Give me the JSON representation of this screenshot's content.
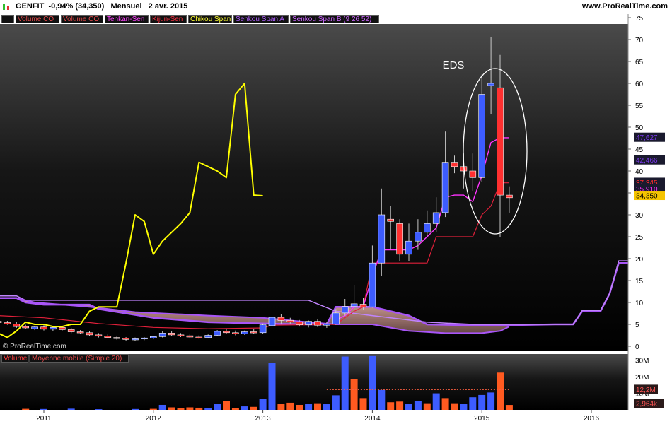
{
  "header": {
    "ticker_line": "GENFIT  -0,94% (34,350)   Mensuel   2 avr. 2015",
    "site": "www.ProRealTime.com",
    "copyright": "© ProRealTime.com"
  },
  "legend": [
    {
      "label": "",
      "color": "#bbbbbb"
    },
    {
      "label": "Volume CO",
      "color": "#e34a4a"
    },
    {
      "label": "Volume CO",
      "color": "#e34a4a"
    },
    {
      "label": "Tenkan-Sen",
      "color": "#ff44ff"
    },
    {
      "label": "Kijun-Sen",
      "color": "#ff3344"
    },
    {
      "label": "Chikou Span",
      "color": "#ffff33"
    },
    {
      "label": "Senkou Span A",
      "color": "#b060ff"
    },
    {
      "label": "Senkou Span B (9 26 52)",
      "color": "#cc66ff"
    }
  ],
  "volume_legend": [
    {
      "label": "Volume",
      "color": "#ff4040"
    },
    {
      "label": "Moyenne mobile (Simple 20)",
      "color": "#e34a4a"
    }
  ],
  "annotation": "EDS",
  "colors": {
    "up": "#3d5cff",
    "down": "#ff3030",
    "vol_up": "#3d5cff",
    "vol_down": "#ff5a20",
    "tenkan": "#ff33ff",
    "kijun": "#e0203a",
    "chikou": "#ffff00",
    "senkou_b": "#a855f7",
    "cloud_top": "#e7b0a6",
    "cloud_bottom": "#6b4a48"
  },
  "chart_data": {
    "type": "candlestick",
    "title": "GENFIT Mensuel",
    "ylim": [
      0,
      76
    ],
    "y_ticks": [
      "0",
      "5",
      "10",
      "15",
      "20",
      "25",
      "30",
      "35",
      "40",
      "45",
      "50",
      "55",
      "60",
      "65",
      "70",
      "75"
    ],
    "x_axis_ticks": [
      {
        "label": "2011",
        "m": 0
      },
      {
        "label": "2012",
        "m": 12
      },
      {
        "label": "2013",
        "m": 24
      },
      {
        "label": "2014",
        "m": 36
      },
      {
        "label": "2015",
        "m": 48
      },
      {
        "label": "2016",
        "m": 60
      }
    ],
    "price_labels": [
      {
        "text": "47,627",
        "value": 47.627,
        "color": "#7c3aed"
      },
      {
        "text": "42,466",
        "value": 42.466,
        "color": "#7c3aed"
      },
      {
        "text": "37,345",
        "value": 37.345,
        "color": "#ff2d2d"
      },
      {
        "text": "35,910",
        "value": 35.91,
        "color": "#ff2dff"
      },
      {
        "text": "34,350",
        "value": 34.35,
        "color": "#f5c400"
      }
    ],
    "candles": [
      {
        "m": -5,
        "o": 5.7,
        "h": 6.2,
        "l": 5.0,
        "c": 5.4
      },
      {
        "m": -4,
        "o": 5.4,
        "h": 5.8,
        "l": 4.9,
        "c": 5.1
      },
      {
        "m": -3,
        "o": 5.1,
        "h": 5.5,
        "l": 4.2,
        "c": 4.5
      },
      {
        "m": -2,
        "o": 4.5,
        "h": 4.9,
        "l": 3.9,
        "c": 4.2
      },
      {
        "m": -1,
        "o": 4.0,
        "h": 4.6,
        "l": 3.7,
        "c": 4.4
      },
      {
        "m": 0,
        "o": 4.4,
        "h": 4.8,
        "l": 3.6,
        "c": 3.9
      },
      {
        "m": 1,
        "o": 3.9,
        "h": 4.5,
        "l": 3.4,
        "c": 4.3
      },
      {
        "m": 2,
        "o": 4.3,
        "h": 4.6,
        "l": 3.5,
        "c": 3.8
      },
      {
        "m": 3,
        "o": 3.8,
        "h": 4.2,
        "l": 3.0,
        "c": 3.3
      },
      {
        "m": 4,
        "o": 3.3,
        "h": 3.7,
        "l": 2.8,
        "c": 3.1
      },
      {
        "m": 5,
        "o": 3.1,
        "h": 3.4,
        "l": 2.3,
        "c": 2.6
      },
      {
        "m": 6,
        "o": 2.6,
        "h": 3.0,
        "l": 2.0,
        "c": 2.3
      },
      {
        "m": 7,
        "o": 2.3,
        "h": 2.7,
        "l": 1.8,
        "c": 2.0
      },
      {
        "m": 8,
        "o": 2.0,
        "h": 2.4,
        "l": 1.5,
        "c": 1.8
      },
      {
        "m": 9,
        "o": 1.8,
        "h": 2.1,
        "l": 1.3,
        "c": 1.6
      },
      {
        "m": 10,
        "o": 1.6,
        "h": 2.0,
        "l": 1.2,
        "c": 1.7
      },
      {
        "m": 11,
        "o": 1.7,
        "h": 2.1,
        "l": 1.4,
        "c": 1.9
      },
      {
        "m": 12,
        "o": 1.9,
        "h": 2.4,
        "l": 1.6,
        "c": 2.2
      },
      {
        "m": 13,
        "o": 2.2,
        "h": 3.5,
        "l": 2.0,
        "c": 3.0
      },
      {
        "m": 14,
        "o": 3.0,
        "h": 3.4,
        "l": 2.4,
        "c": 2.6
      },
      {
        "m": 15,
        "o": 2.6,
        "h": 3.0,
        "l": 2.1,
        "c": 2.4
      },
      {
        "m": 16,
        "o": 2.4,
        "h": 2.8,
        "l": 1.8,
        "c": 2.1
      },
      {
        "m": 17,
        "o": 2.1,
        "h": 2.5,
        "l": 1.7,
        "c": 2.0
      },
      {
        "m": 18,
        "o": 2.0,
        "h": 2.7,
        "l": 1.8,
        "c": 2.5
      },
      {
        "m": 19,
        "o": 2.5,
        "h": 3.7,
        "l": 2.3,
        "c": 3.4
      },
      {
        "m": 20,
        "o": 3.4,
        "h": 3.9,
        "l": 2.8,
        "c": 3.1
      },
      {
        "m": 21,
        "o": 3.1,
        "h": 3.6,
        "l": 2.5,
        "c": 2.8
      },
      {
        "m": 22,
        "o": 2.8,
        "h": 3.6,
        "l": 2.6,
        "c": 3.3
      },
      {
        "m": 23,
        "o": 3.3,
        "h": 4.0,
        "l": 2.9,
        "c": 3.1
      },
      {
        "m": 24,
        "o": 3.1,
        "h": 5.2,
        "l": 2.9,
        "c": 4.9
      },
      {
        "m": 25,
        "o": 4.7,
        "h": 8.5,
        "l": 4.5,
        "c": 6.6
      },
      {
        "m": 26,
        "o": 6.6,
        "h": 7.3,
        "l": 5.1,
        "c": 5.9
      },
      {
        "m": 27,
        "o": 5.9,
        "h": 6.5,
        "l": 5.0,
        "c": 5.6
      },
      {
        "m": 28,
        "o": 5.6,
        "h": 6.0,
        "l": 4.5,
        "c": 4.9
      },
      {
        "m": 29,
        "o": 4.9,
        "h": 5.9,
        "l": 4.3,
        "c": 5.7
      },
      {
        "m": 30,
        "o": 5.7,
        "h": 6.3,
        "l": 4.4,
        "c": 4.8
      },
      {
        "m": 31,
        "o": 4.8,
        "h": 5.6,
        "l": 4.2,
        "c": 5.1
      },
      {
        "m": 32,
        "o": 5.1,
        "h": 8.5,
        "l": 4.9,
        "c": 7.6
      },
      {
        "m": 33,
        "o": 7.6,
        "h": 10.8,
        "l": 7.0,
        "c": 9.1
      },
      {
        "m": 34,
        "o": 9.1,
        "h": 14.0,
        "l": 8.0,
        "c": 9.7
      },
      {
        "m": 35,
        "o": 9.6,
        "h": 11.0,
        "l": 8.3,
        "c": 9.0
      },
      {
        "m": 36,
        "o": 9.0,
        "h": 23.0,
        "l": 8.8,
        "c": 19.0
      },
      {
        "m": 37,
        "o": 19.0,
        "h": 36.0,
        "l": 16.0,
        "c": 30.0
      },
      {
        "m": 38,
        "o": 29.0,
        "h": 32.0,
        "l": 22.0,
        "c": 28.5
      },
      {
        "m": 39,
        "o": 28.0,
        "h": 29.0,
        "l": 19.5,
        "c": 21.0
      },
      {
        "m": 40,
        "o": 21.0,
        "h": 28.0,
        "l": 19.5,
        "c": 24.0
      },
      {
        "m": 41,
        "o": 24.0,
        "h": 29.0,
        "l": 22.0,
        "c": 26.0
      },
      {
        "m": 42,
        "o": 26.0,
        "h": 31.0,
        "l": 25.0,
        "c": 28.0
      },
      {
        "m": 43,
        "o": 28.0,
        "h": 34.0,
        "l": 26.0,
        "c": 30.5
      },
      {
        "m": 44,
        "o": 30.5,
        "h": 49.0,
        "l": 29.5,
        "c": 42.0
      },
      {
        "m": 45,
        "o": 42.0,
        "h": 43.5,
        "l": 39.5,
        "c": 41.0
      },
      {
        "m": 46,
        "o": 41.0,
        "h": 44.0,
        "l": 36.0,
        "c": 40.0
      },
      {
        "m": 47,
        "o": 40.0,
        "h": 44.0,
        "l": 35.5,
        "c": 38.5
      },
      {
        "m": 48,
        "o": 38.5,
        "h": 62.0,
        "l": 37.5,
        "c": 57.5
      },
      {
        "m": 49,
        "o": 59.5,
        "h": 70.5,
        "l": 53.0,
        "c": 60.0
      },
      {
        "m": 50,
        "o": 59.0,
        "h": 66.5,
        "l": 25.0,
        "c": 34.5
      },
      {
        "m": 51,
        "o": 34.5,
        "h": 36.5,
        "l": 30.5,
        "c": 33.9
      }
    ],
    "tenkan": [
      {
        "m": 32,
        "v": 6.0
      },
      {
        "m": 33,
        "v": 7.0
      },
      {
        "m": 34,
        "v": 9.0
      },
      {
        "m": 35,
        "v": 9.0
      },
      {
        "m": 36,
        "v": 16.0
      },
      {
        "m": 37,
        "v": 22.0
      },
      {
        "m": 38,
        "v": 22.0
      },
      {
        "m": 39,
        "v": 22.0
      },
      {
        "m": 40,
        "v": 22.0
      },
      {
        "m": 41,
        "v": 23.0
      },
      {
        "m": 42,
        "v": 25.0
      },
      {
        "m": 43,
        "v": 27.0
      },
      {
        "m": 44,
        "v": 34.0
      },
      {
        "m": 45,
        "v": 34.5
      },
      {
        "m": 46,
        "v": 34.5
      },
      {
        "m": 47,
        "v": 33.0
      },
      {
        "m": 48,
        "v": 39.0
      },
      {
        "m": 49,
        "v": 46.5
      },
      {
        "m": 50,
        "v": 47.6
      },
      {
        "m": 51,
        "v": 47.6
      }
    ],
    "kijun": [
      {
        "m": -5,
        "v": 7.0
      },
      {
        "m": 0,
        "v": 6.5
      },
      {
        "m": 6,
        "v": 5.2
      },
      {
        "m": 12,
        "v": 4.3
      },
      {
        "m": 18,
        "v": 4.0
      },
      {
        "m": 24,
        "v": 4.2
      },
      {
        "m": 25,
        "v": 4.8
      },
      {
        "m": 32,
        "v": 5.0
      },
      {
        "m": 34,
        "v": 8.0
      },
      {
        "m": 35,
        "v": 9.0
      },
      {
        "m": 36,
        "v": 19.0
      },
      {
        "m": 42,
        "v": 19.0
      },
      {
        "m": 43,
        "v": 25.0
      },
      {
        "m": 47,
        "v": 25.0
      },
      {
        "m": 48,
        "v": 30.0
      },
      {
        "m": 49,
        "v": 32.0
      },
      {
        "m": 50,
        "v": 37.3
      },
      {
        "m": 51,
        "v": 37.3
      }
    ],
    "chikou": [
      {
        "m": -5,
        "v": 3.0
      },
      {
        "m": -4,
        "v": 2.0
      },
      {
        "m": -3,
        "v": 3.5
      },
      {
        "m": -2,
        "v": 5.5
      },
      {
        "m": -1,
        "v": 5.0
      },
      {
        "m": 0,
        "v": 5.0
      },
      {
        "m": 1,
        "v": 4.5
      },
      {
        "m": 2,
        "v": 4.5
      },
      {
        "m": 3,
        "v": 5.0
      },
      {
        "m": 4,
        "v": 5.0
      },
      {
        "m": 5,
        "v": 8.0
      },
      {
        "m": 6,
        "v": 9.0
      },
      {
        "m": 7,
        "v": 9.0
      },
      {
        "m": 8,
        "v": 9.0
      },
      {
        "m": 9,
        "v": 19.0
      },
      {
        "m": 10,
        "v": 30.0
      },
      {
        "m": 11,
        "v": 28.5
      },
      {
        "m": 12,
        "v": 21.0
      },
      {
        "m": 13,
        "v": 24.0
      },
      {
        "m": 14,
        "v": 26.0
      },
      {
        "m": 15,
        "v": 28.0
      },
      {
        "m": 16,
        "v": 30.5
      },
      {
        "m": 17,
        "v": 42.0
      },
      {
        "m": 18,
        "v": 41.0
      },
      {
        "m": 19,
        "v": 40.0
      },
      {
        "m": 20,
        "v": 38.5
      },
      {
        "m": 21,
        "v": 57.5
      },
      {
        "m": 22,
        "v": 60.0
      },
      {
        "m": 23,
        "v": 34.5
      },
      {
        "m": 24,
        "v": 34.35
      }
    ],
    "senkou_a": [
      {
        "m": -5,
        "v": 11.0
      },
      {
        "m": -3,
        "v": 11.0
      },
      {
        "m": -2,
        "v": 10.0
      },
      {
        "m": 0,
        "v": 9.5
      },
      {
        "m": 5,
        "v": 9.5
      },
      {
        "m": 6,
        "v": 8.5
      },
      {
        "m": 12,
        "v": 6.5
      },
      {
        "m": 18,
        "v": 5.5
      },
      {
        "m": 24,
        "v": 5.2
      },
      {
        "m": 29,
        "v": 5.0
      },
      {
        "m": 31,
        "v": 5.0
      },
      {
        "m": 32,
        "v": 9.0
      },
      {
        "m": 36,
        "v": 9.0
      },
      {
        "m": 40,
        "v": 7.0
      },
      {
        "m": 42,
        "v": 5.0
      },
      {
        "m": 47,
        "v": 4.8
      },
      {
        "m": 50,
        "v": 4.8
      },
      {
        "m": 56,
        "v": 5.0
      },
      {
        "m": 58,
        "v": 5.0
      },
      {
        "m": 59,
        "v": 8.0
      },
      {
        "m": 61,
        "v": 8.0
      },
      {
        "m": 62,
        "v": 12.0
      },
      {
        "m": 63,
        "v": 19.0
      },
      {
        "m": 64,
        "v": 19.0
      }
    ],
    "senkou_b": [
      {
        "m": -5,
        "v": 11.5
      },
      {
        "m": -3,
        "v": 11.5
      },
      {
        "m": -2,
        "v": 10.5
      },
      {
        "m": 0,
        "v": 10.5
      },
      {
        "m": 12,
        "v": 10.5
      },
      {
        "m": 24,
        "v": 10.5
      },
      {
        "m": 29,
        "v": 10.5
      },
      {
        "m": 32,
        "v": 8.0
      },
      {
        "m": 36,
        "v": 7.0
      },
      {
        "m": 42,
        "v": 5.5
      },
      {
        "m": 47,
        "v": 5.0
      },
      {
        "m": 52,
        "v": 5.0
      },
      {
        "m": 58,
        "v": 5.0
      },
      {
        "m": 59,
        "v": 8.2
      },
      {
        "m": 61,
        "v": 8.2
      },
      {
        "m": 62,
        "v": 12.0
      },
      {
        "m": 63,
        "v": 19.5
      },
      {
        "m": 64,
        "v": 19.5
      }
    ],
    "cloud_low": [
      {
        "m": -5,
        "v": 11.0
      },
      {
        "m": -3,
        "v": 11.0
      },
      {
        "m": -1,
        "v": 10.0
      },
      {
        "m": 5,
        "v": 9.0
      },
      {
        "m": 10,
        "v": 7.8
      },
      {
        "m": 18,
        "v": 7.0
      },
      {
        "m": 24,
        "v": 6.5
      },
      {
        "m": 29,
        "v": 5.5
      },
      {
        "m": 32,
        "v": 5.0
      },
      {
        "m": 36,
        "v": 5.0
      },
      {
        "m": 40,
        "v": 3.5
      },
      {
        "m": 44,
        "v": 3.0
      },
      {
        "m": 48,
        "v": 3.0
      },
      {
        "m": 50,
        "v": 3.5
      },
      {
        "m": 51,
        "v": 4.5
      }
    ],
    "volume": {
      "y_ticks": [
        {
          "label": "10M",
          "value": 10
        },
        {
          "label": "20M",
          "value": 20
        },
        {
          "label": "30M",
          "value": 30
        }
      ],
      "ylim": [
        0,
        32
      ],
      "ma_label": "12,2M",
      "ma_value": 12.2,
      "last_label": "2,964k",
      "bars": [
        {
          "m": -2,
          "v": 0.6,
          "up": false
        },
        {
          "m": 0,
          "v": 0.5,
          "up": true
        },
        {
          "m": 3,
          "v": 0.7,
          "up": true
        },
        {
          "m": 6,
          "v": 0.4,
          "up": true
        },
        {
          "m": 10,
          "v": 0.5,
          "up": true
        },
        {
          "m": 12,
          "v": 0.6,
          "up": false
        },
        {
          "m": 13,
          "v": 3.0,
          "up": true
        },
        {
          "m": 14,
          "v": 1.5,
          "up": false
        },
        {
          "m": 15,
          "v": 1.2,
          "up": false
        },
        {
          "m": 16,
          "v": 1.5,
          "up": false
        },
        {
          "m": 17,
          "v": 1.3,
          "up": false
        },
        {
          "m": 18,
          "v": 1.2,
          "up": true
        },
        {
          "m": 19,
          "v": 3.7,
          "up": true
        },
        {
          "m": 20,
          "v": 5.3,
          "up": false
        },
        {
          "m": 21,
          "v": 1.2,
          "up": false
        },
        {
          "m": 22,
          "v": 2.1,
          "up": true
        },
        {
          "m": 23,
          "v": 1.8,
          "up": false
        },
        {
          "m": 24,
          "v": 6.5,
          "up": true
        },
        {
          "m": 25,
          "v": 28.3,
          "up": true
        },
        {
          "m": 26,
          "v": 3.7,
          "up": false
        },
        {
          "m": 27,
          "v": 4.3,
          "up": false
        },
        {
          "m": 28,
          "v": 3.0,
          "up": false
        },
        {
          "m": 29,
          "v": 3.5,
          "up": true
        },
        {
          "m": 30,
          "v": 4.0,
          "up": false
        },
        {
          "m": 31,
          "v": 3.5,
          "up": true
        },
        {
          "m": 32,
          "v": 8.8,
          "up": true
        },
        {
          "m": 33,
          "v": 32.2,
          "up": true
        },
        {
          "m": 34,
          "v": 18.7,
          "up": false
        },
        {
          "m": 35,
          "v": 7.1,
          "up": false
        },
        {
          "m": 36,
          "v": 32.5,
          "up": true
        },
        {
          "m": 37,
          "v": 12.0,
          "up": true
        },
        {
          "m": 38,
          "v": 4.6,
          "up": false
        },
        {
          "m": 39,
          "v": 5.0,
          "up": false
        },
        {
          "m": 40,
          "v": 3.7,
          "up": true
        },
        {
          "m": 41,
          "v": 5.4,
          "up": true
        },
        {
          "m": 42,
          "v": 4.0,
          "up": false
        },
        {
          "m": 43,
          "v": 10.0,
          "up": true
        },
        {
          "m": 44,
          "v": 7.1,
          "up": false
        },
        {
          "m": 45,
          "v": 4.0,
          "up": false
        },
        {
          "m": 46,
          "v": 3.7,
          "up": true
        },
        {
          "m": 47,
          "v": 7.6,
          "up": true
        },
        {
          "m": 48,
          "v": 9.0,
          "up": true
        },
        {
          "m": 49,
          "v": 10.5,
          "up": true
        },
        {
          "m": 50,
          "v": 22.5,
          "up": false
        },
        {
          "m": 51,
          "v": 2.96,
          "up": false
        }
      ]
    }
  }
}
